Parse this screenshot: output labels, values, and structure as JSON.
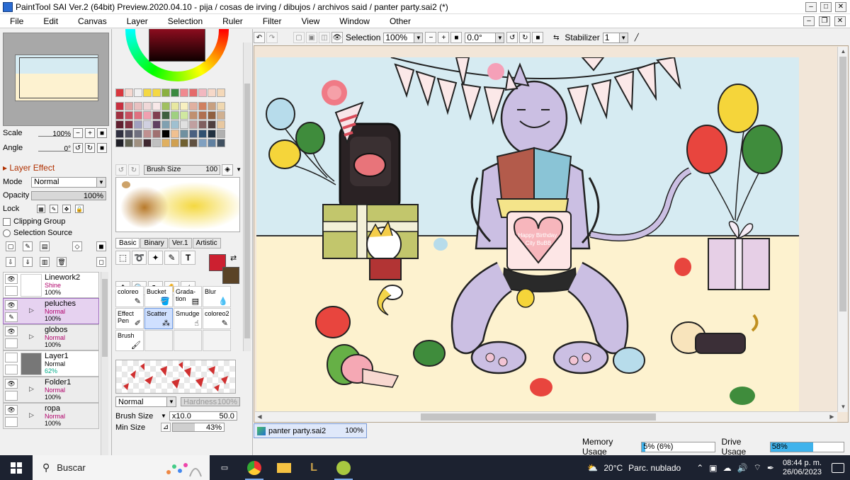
{
  "window": {
    "title": "PaintTool SAI Ver.2 (64bit) Preview.2020.04.10 - pija / cosas de irving / dibujos / archivos said / panter party.sai2 (*)"
  },
  "menu": [
    "File",
    "Edit",
    "Canvas",
    "Layer",
    "Selection",
    "Ruler",
    "Filter",
    "View",
    "Window",
    "Other"
  ],
  "navigator": {
    "scale_label": "Scale",
    "scale_value": "100%",
    "angle_label": "Angle",
    "angle_value": "0°"
  },
  "layer_effect": {
    "header": "Layer Effect",
    "mode_label": "Mode",
    "mode_value": "Normal",
    "opacity_label": "Opacity",
    "opacity_value": "100%",
    "lock_label": "Lock",
    "clipping_label": "Clipping Group",
    "selection_source_label": "Selection Source"
  },
  "layers": [
    {
      "name": "Linework2",
      "mode": "Shine",
      "opacity": "100%"
    },
    {
      "name": "peluches",
      "mode": "Normal",
      "opacity": "100%"
    },
    {
      "name": "globos",
      "mode": "Normal",
      "opacity": "100%"
    },
    {
      "name": "Layer1",
      "mode": "Normal",
      "opacity": "62%"
    },
    {
      "name": "Folder1",
      "mode": "Normal",
      "opacity": "100%"
    },
    {
      "name": "ropa",
      "mode": "Normal",
      "opacity": "100%"
    }
  ],
  "colors": {
    "foreground": "#cc2030",
    "background": "#5a4326",
    "accent_selection": "#e6d2f0",
    "swatch_row": [
      "#d9373e",
      "#f6d8d0",
      "#f0f0f0",
      "#f4d843",
      "#f4d843",
      "#8ab040",
      "#3a8a40",
      "#f08a90",
      "#e56a6a",
      "#f2b8c0",
      "#f6d8c8",
      "#f4d8b8"
    ],
    "swatch_grid": [
      "#c83040",
      "#e0a0a0",
      "#e8c0c0",
      "#f0d8d8",
      "#f8e8e8",
      "#a0c060",
      "#e8e8a0",
      "#f8f0c0",
      "#e0b0a0",
      "#d08060",
      "#c8a080",
      "#f0d8b0",
      "#a03040",
      "#c85060",
      "#e07080",
      "#f0a0b0",
      "#804050",
      "#406040",
      "#a0d080",
      "#d0e8a0",
      "#c09070",
      "#b07050",
      "#906040",
      "#d0b090",
      "#602030",
      "#803040",
      "#a0a0c0",
      "#d0d0e0",
      "#604060",
      "#80a0b0",
      "#a0c0d0",
      "#e0e0e0",
      "#c0a0a0",
      "#806060",
      "#504040",
      "#e8c8a0",
      "#303040",
      "#505060",
      "#707080",
      "#c09090",
      "#a07070",
      "#000000",
      "#f0c090",
      "#7090a0",
      "#4a6080",
      "#305070",
      "#203040",
      "#b0b0b0",
      "#202028",
      "#606050",
      "#a09080",
      "#402830",
      "#c0c0c0",
      "#e0b060",
      "#d0a050",
      "#706030",
      "#605040",
      "#80a0c0",
      "#6080a0",
      "#405060"
    ]
  },
  "brush_size": {
    "label": "Brush Size",
    "value": "100"
  },
  "tabs": [
    "Basic",
    "Binary",
    "Ver.1",
    "Artistic"
  ],
  "brushes": [
    {
      "label": "coloreo",
      "icon": "pen-icon"
    },
    {
      "label": "Bucket",
      "icon": "bucket-icon"
    },
    {
      "label": "Grada-\ntion",
      "icon": "gradient-icon"
    },
    {
      "label": "Blur",
      "icon": "drop-icon"
    },
    {
      "label": "Effect\nPen",
      "icon": "effect-pen-icon"
    },
    {
      "label": "Scatter",
      "icon": "scatter-icon"
    },
    {
      "label": "Smudge",
      "icon": "smudge-icon"
    },
    {
      "label": "coloreo2",
      "icon": "pen-icon"
    },
    {
      "label": "Brush",
      "icon": "brush-icon"
    }
  ],
  "brush_settings": {
    "blend_mode": "Normal",
    "hardness_label": "Hardness",
    "hardness_value": "100%",
    "size_label": "Brush Size",
    "size_multiplier": "x10.0",
    "size_value": "50.0",
    "min_size_label": "Min Size",
    "min_size_value": "43%"
  },
  "toolbar": {
    "selection_label": "Selection",
    "zoom": "100%",
    "angle": "0.0°",
    "stabilizer_label": "Stabilizer",
    "stabilizer_value": "1"
  },
  "canvas": {
    "banner_text": "Happy Birthday\nCity BuBB"
  },
  "document_tab": {
    "name": "panter party.sai2",
    "zoom": "100%"
  },
  "status": {
    "memory_label": "Memory Usage",
    "memory_value": "5% (6%)",
    "memory_fraction": 0.05,
    "drive_label": "Drive Usage",
    "drive_value": "58%",
    "drive_fraction": 0.58
  },
  "taskbar": {
    "search_placeholder": "Buscar",
    "weather_temp": "20°C",
    "weather_text": "Parc. nublado",
    "time": "08:44 p. m.",
    "date": "26/06/2023"
  }
}
